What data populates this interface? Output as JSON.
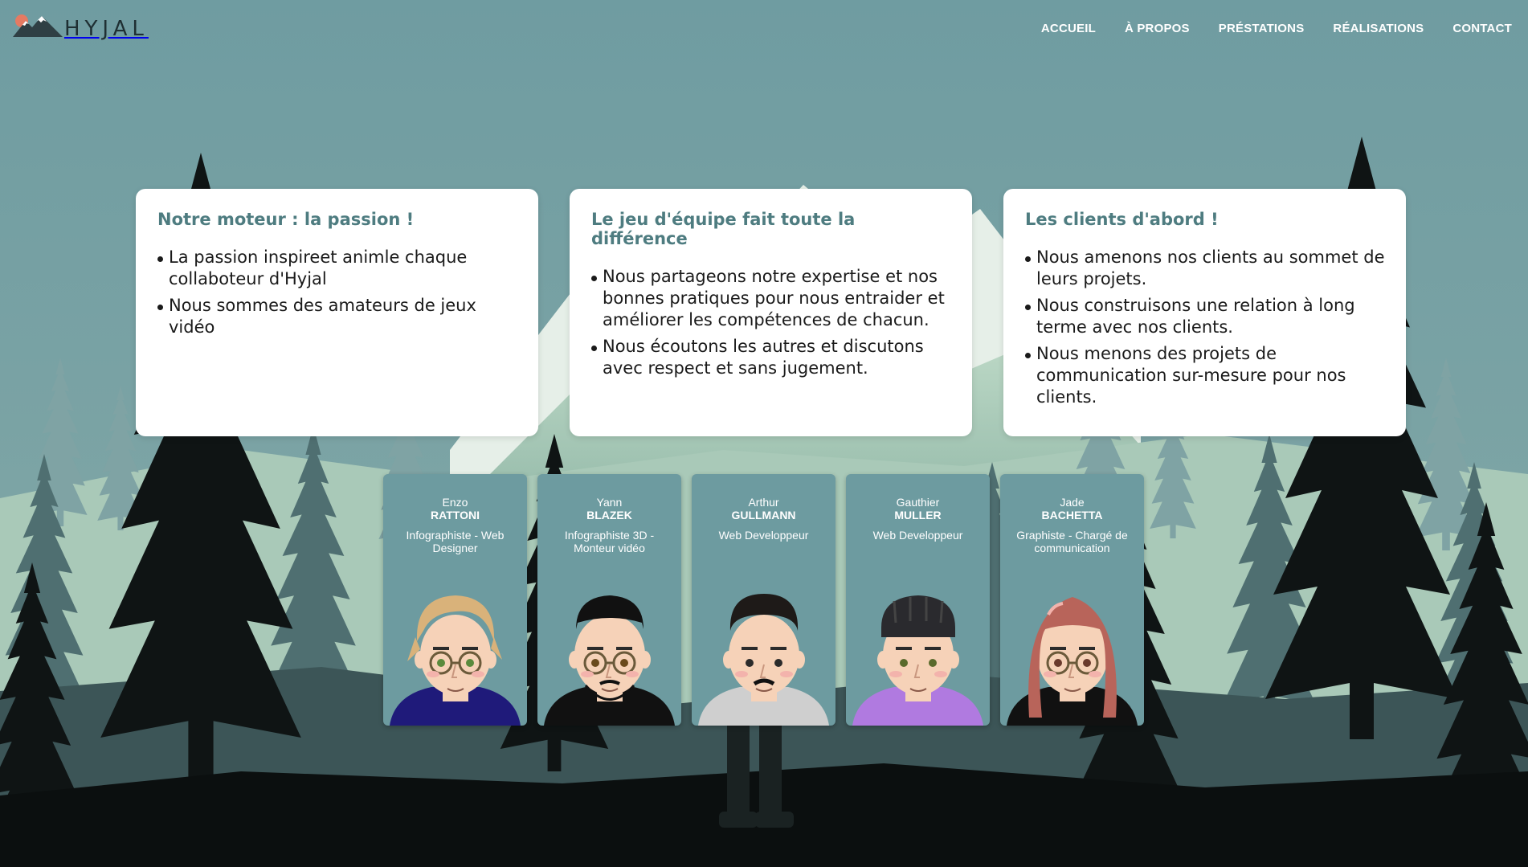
{
  "brand": {
    "name": "HYJAL"
  },
  "nav": {
    "items": [
      "ACCUEIL",
      "À PROPOS",
      "PRÉSTATIONS",
      "RÉALISATIONS",
      "CONTACT"
    ]
  },
  "values": [
    {
      "title": "Notre moteur : la passion !",
      "points": [
        "La passion inspireet animle chaque collaboteur d'Hyjal",
        "Nous sommes des amateurs de jeux vidéo"
      ]
    },
    {
      "title": "Le jeu d'équipe fait toute la différence",
      "points": [
        "Nous partageons notre expertise et nos bonnes pratiques pour nous entraider et améliorer les compétences de chacun.",
        "Nous écoutons les autres et discutons avec respect et sans jugement."
      ]
    },
    {
      "title": "Les clients d'abord !",
      "points": [
        "Nous amenons nos clients au sommet de leurs projets.",
        "Nous construisons une relation à long terme avec nos clients.",
        "Nous menons des projets de communication sur-mesure pour nos clients."
      ]
    }
  ],
  "team": [
    {
      "first": "Enzo",
      "last": "RATTONI",
      "role": "Infographiste - Web Designer",
      "hair": "#d9b27a",
      "shirt": "#1f1a7a",
      "skin": "#f6d2b8",
      "eyes": "#5a8a3c"
    },
    {
      "first": "Yann",
      "last": "BLAZEK",
      "role": "Infographiste 3D - Monteur vidéo",
      "hair": "#111111",
      "shirt": "#111111",
      "skin": "#f6d2b8",
      "eyes": "#6a4a1c"
    },
    {
      "first": "Arthur",
      "last": "GULLMANN",
      "role": "Web Developpeur",
      "hair": "#1e1a18",
      "shirt": "#cfcfcf",
      "skin": "#f6d2b8",
      "eyes": "#2b2b2b"
    },
    {
      "first": "Gauthier",
      "last": "MULLER",
      "role": "Web Developpeur",
      "hair": "#2a2a2e",
      "shirt": "#b07ae0",
      "skin": "#f6d2b8",
      "eyes": "#5a6a2c"
    },
    {
      "first": "Jade",
      "last": "BACHETTA",
      "role": "Graphiste - Chargé de communication",
      "hair": "#b8645a",
      "shirt": "#111111",
      "skin": "#f6d2b8",
      "eyes": "#6a3a2c"
    }
  ],
  "colors": {
    "sky": "#6f9ca1",
    "mountain": "#dfe9e2",
    "forest_far": "#7fa3a4",
    "forest_mid": "#4a6a6c",
    "forest_near": "#0f1414",
    "card_title": "#4e7c80"
  }
}
